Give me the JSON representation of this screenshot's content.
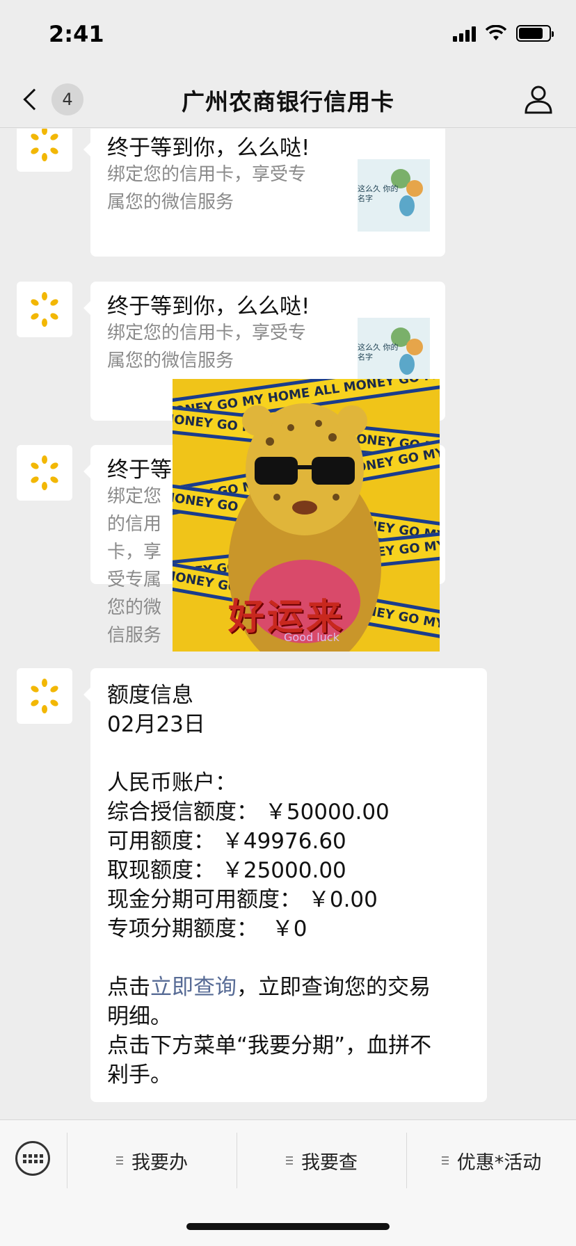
{
  "status_bar": {
    "time": "2:41",
    "battery_level": 0.8
  },
  "nav": {
    "unread_count": "4",
    "title": "广州农商银行信用卡"
  },
  "messages": [
    {
      "title": "终于等到你，么么哒!",
      "desc": "绑定您的信用卡，享受专属您的微信服务",
      "thumb_text": "这么久 你的名字 "
    },
    {
      "title": "终于等到你，么么哒!",
      "desc": "绑定您的信用卡，享受专属您的微信服务",
      "thumb_text": "这么久 你的名字 "
    },
    {
      "title": "终于等",
      "desc": "绑定您的信用卡，享受专属您的微信服务",
      "thumb_text": ""
    }
  ],
  "sticker": {
    "stripe_text": "ALL MONEY GO MY HOME ALL MONEY GO MY HOME",
    "caption": "好运来",
    "subcaption": "Good luck"
  },
  "info": {
    "title": "额度信息",
    "date": "02月23日",
    "account": "人民币账户：",
    "lines": [
      "综合授信额度： ￥50000.00",
      "可用额度： ￥49976.60",
      "取现额度： ￥25000.00",
      "现金分期可用额度： ￥0.00",
      "专项分期额度：  ￥0"
    ],
    "click_prefix": "点击",
    "link_text": "立即查询",
    "click_suffix_1": "，立即查询您的交易",
    "click_suffix_2": "明细。",
    "menu_hint_1": "点击下方菜单“我要分期”，血拼不",
    "menu_hint_2": "剁手。"
  },
  "menu": {
    "items": [
      "我要办",
      "我要查",
      "优惠*活动"
    ]
  }
}
